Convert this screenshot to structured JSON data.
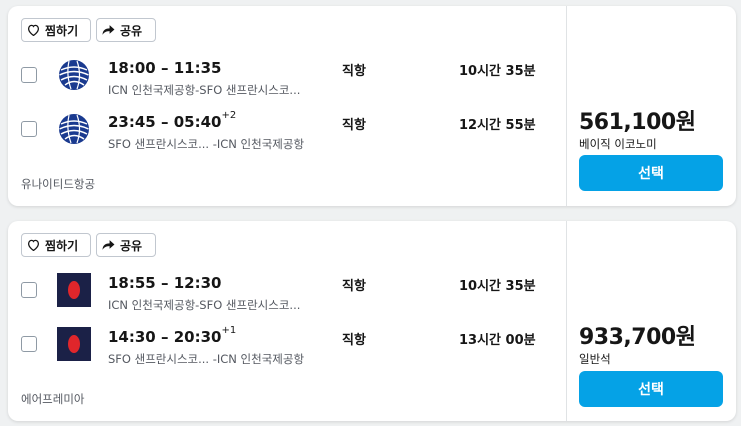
{
  "actions": {
    "save_label": "찜하기",
    "share_label": "공유"
  },
  "results": [
    {
      "airline": "유나이티드항공",
      "logo_icon": "united-globe-icon",
      "price": "561,100원",
      "fare_class": "베이직 이코노미",
      "select_label": "선택",
      "legs": [
        {
          "times": "18:00 – 11:35",
          "day_offset": "",
          "route": "ICN 인천국제공항-SFO 샌프란시스코...",
          "stops": "직항",
          "duration": "10시간 35분"
        },
        {
          "times": "23:45 – 05:40",
          "day_offset": "+2",
          "route": "SFO 샌프란시스코... -ICN 인천국제공항",
          "stops": "직항",
          "duration": "12시간 55분"
        }
      ]
    },
    {
      "airline": "에어프레미아",
      "logo_icon": "air-premia-icon",
      "price": "933,700원",
      "fare_class": "일반석",
      "select_label": "선택",
      "legs": [
        {
          "times": "18:55 – 12:30",
          "day_offset": "",
          "route": "ICN 인천국제공항-SFO 샌프란시스코...",
          "stops": "직항",
          "duration": "10시간 35분"
        },
        {
          "times": "14:30 – 20:30",
          "day_offset": "+1",
          "route": "SFO 샌프란시스코... -ICN 인천국제공항",
          "stops": "직항",
          "duration": "13시간 00분"
        }
      ]
    }
  ],
  "colors": {
    "accent": "#05a2e6",
    "united_blue": "#1a3a8f",
    "air_premia_navy": "#1b2147",
    "air_premia_red": "#e0262b"
  }
}
